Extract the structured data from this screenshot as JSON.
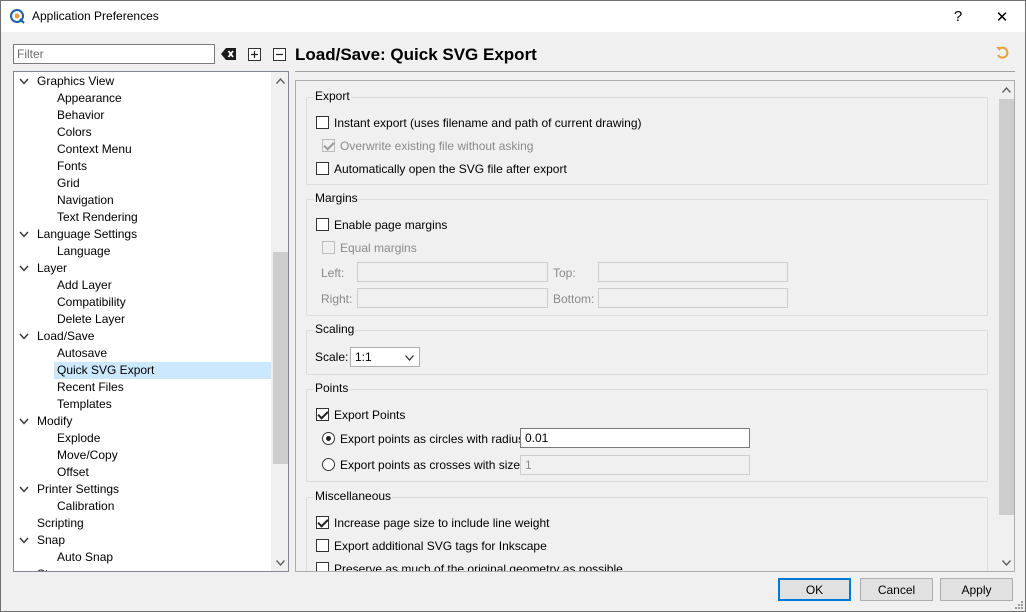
{
  "window": {
    "title": "Application Preferences",
    "help_glyph": "?",
    "close_glyph": "✕"
  },
  "filter": {
    "placeholder": "Filter",
    "value": ""
  },
  "tree": {
    "items": [
      {
        "label": "Graphics View",
        "level": 0,
        "expanded": true
      },
      {
        "label": "Appearance",
        "level": 1
      },
      {
        "label": "Behavior",
        "level": 1
      },
      {
        "label": "Colors",
        "level": 1
      },
      {
        "label": "Context Menu",
        "level": 1
      },
      {
        "label": "Fonts",
        "level": 1
      },
      {
        "label": "Grid",
        "level": 1
      },
      {
        "label": "Navigation",
        "level": 1
      },
      {
        "label": "Text Rendering",
        "level": 1
      },
      {
        "label": "Language Settings",
        "level": 0,
        "expanded": true
      },
      {
        "label": "Language",
        "level": 1
      },
      {
        "label": "Layer",
        "level": 0,
        "expanded": true
      },
      {
        "label": "Add Layer",
        "level": 1
      },
      {
        "label": "Compatibility",
        "level": 1
      },
      {
        "label": "Delete Layer",
        "level": 1
      },
      {
        "label": "Load/Save",
        "level": 0,
        "expanded": true
      },
      {
        "label": "Autosave",
        "level": 1
      },
      {
        "label": "Quick SVG Export",
        "level": 1,
        "selected": true
      },
      {
        "label": "Recent Files",
        "level": 1
      },
      {
        "label": "Templates",
        "level": 1
      },
      {
        "label": "Modify",
        "level": 0,
        "expanded": true
      },
      {
        "label": "Explode",
        "level": 1
      },
      {
        "label": "Move/Copy",
        "level": 1
      },
      {
        "label": "Offset",
        "level": 1
      },
      {
        "label": "Printer Settings",
        "level": 0,
        "expanded": true
      },
      {
        "label": "Calibration",
        "level": 1
      },
      {
        "label": "Scripting",
        "level": 0
      },
      {
        "label": "Snap",
        "level": 0,
        "expanded": true
      },
      {
        "label": "Auto Snap",
        "level": 1
      },
      {
        "label": "St...",
        "level": 0
      }
    ]
  },
  "page": {
    "title": "Load/Save: Quick SVG Export"
  },
  "export": {
    "title": "Export",
    "instant": {
      "label": "Instant export (uses filename and path of current drawing)",
      "checked": false
    },
    "overwrite": {
      "label": "Overwrite existing file without asking",
      "checked": true,
      "disabled": true
    },
    "auto_open": {
      "label": "Automatically open the SVG file after export",
      "checked": false
    }
  },
  "margins": {
    "title": "Margins",
    "enable": {
      "label": "Enable page margins",
      "checked": false
    },
    "equal": {
      "label": "Equal margins",
      "checked": false,
      "disabled": true
    },
    "left_label": "Left:",
    "top_label": "Top:",
    "right_label": "Right:",
    "bottom_label": "Bottom:",
    "left": "",
    "top": "",
    "right": "",
    "bottom": ""
  },
  "scaling": {
    "title": "Scaling",
    "scale_label": "Scale:",
    "scale_value": "1:1"
  },
  "points": {
    "title": "Points",
    "export_points": {
      "label": "Export Points",
      "checked": true
    },
    "circles": {
      "label": "Export points as circles with radius:",
      "selected": true,
      "value": "0.01"
    },
    "crosses": {
      "label": "Export points as crosses with size:",
      "selected": false,
      "value": "1"
    }
  },
  "misc": {
    "title": "Miscellaneous",
    "increase_page": {
      "label": "Increase page size to include line weight",
      "checked": true
    },
    "inkscape_tags": {
      "label": "Export additional SVG tags for Inkscape",
      "checked": false
    },
    "preserve_geometry": {
      "label": "Preserve as much of the original geometry as possible",
      "checked": false
    }
  },
  "buttons": {
    "ok": "OK",
    "cancel": "Cancel",
    "apply": "Apply"
  },
  "colors": {
    "accent": "#0078d7",
    "selection": "#cce8ff"
  }
}
